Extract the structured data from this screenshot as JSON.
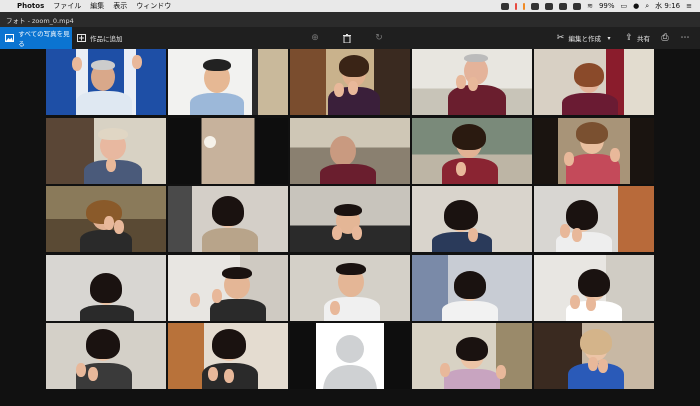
{
  "menubar": {
    "app_name": "Photos",
    "menus": [
      "ファイル",
      "編集",
      "表示",
      "ウィンドウ"
    ],
    "battery": "99%",
    "time": "水 9:16"
  },
  "window": {
    "title": "フォト - zoom_0.mp4"
  },
  "toolbar": {
    "see_all_label": "すべての写真を見る",
    "add_to_creation_label": "作品に追加",
    "edit_create_label": "編集と作成",
    "share_label": "共有"
  },
  "icons": {
    "apple": "apple-icon",
    "photos": "photos-icon",
    "zoom": "zoom-in-icon",
    "delete": "trash-icon",
    "rotate": "rotate-icon",
    "edit": "edit-create-icon",
    "share": "share-icon",
    "print": "print-icon",
    "more": "more-icon"
  },
  "colors": {
    "accent": "#0b74d1",
    "toolbar_bg": "#1f1f1f",
    "title_bg": "#2b2b2b",
    "menubar_bg": "#e9e9e9"
  }
}
